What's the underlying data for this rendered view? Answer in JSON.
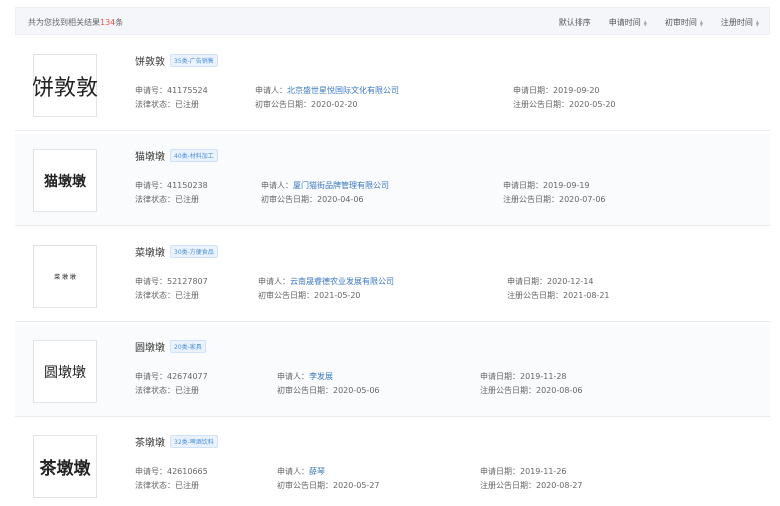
{
  "summary": {
    "prefix": "共为您找到相关结果",
    "count": "134",
    "suffix": "条"
  },
  "sort_options": [
    "默认排序",
    "申请时间",
    "初审时间",
    "注册时间"
  ],
  "labels": {
    "reg_no": "申请号：",
    "status": "法律状态：",
    "applicant": "申请人：",
    "first_pub": "初审公告日期：",
    "apply_date": "申请日期：",
    "reg_pub": "注册公告日期："
  },
  "results": [
    {
      "name": "饼敦敦",
      "tag": "35类-广告销售",
      "reg_no": "41175524",
      "status": "已注册",
      "applicant": "北京盛世星悦国际文化有限公司",
      "first_pub": "2020-02-20",
      "apply_date": "2019-09-20",
      "reg_pub": "2020-05-20",
      "logo_text": "饼敦敦"
    },
    {
      "name": "猫墩墩",
      "tag": "40类-材料加工",
      "reg_no": "41150238",
      "status": "已注册",
      "applicant": "厦门猫街品牌管理有限公司",
      "first_pub": "2020-04-06",
      "apply_date": "2019-09-19",
      "reg_pub": "2020-07-06",
      "logo_text": "猫墩墩"
    },
    {
      "name": "菜墩墩",
      "tag": "30类-方便食品",
      "reg_no": "52127807",
      "status": "已注册",
      "applicant": "云南晟睿德农业发展有限公司",
      "first_pub": "2021-05-20",
      "apply_date": "2020-12-14",
      "reg_pub": "2021-08-21",
      "logo_text": "菜 墩 墩"
    },
    {
      "name": "圆墩墩",
      "tag": "20类-家具",
      "reg_no": "42674077",
      "status": "已注册",
      "applicant": "李发展",
      "first_pub": "2020-05-06",
      "apply_date": "2019-11-28",
      "reg_pub": "2020-08-06",
      "logo_text": "圆墩墩"
    },
    {
      "name": "茶墩墩",
      "tag": "32类-啤酒饮料",
      "reg_no": "42610665",
      "status": "已注册",
      "applicant": "薛琴",
      "first_pub": "2020-05-27",
      "apply_date": "2019-11-26",
      "reg_pub": "2020-08-27",
      "logo_text": "茶墩墩"
    }
  ]
}
